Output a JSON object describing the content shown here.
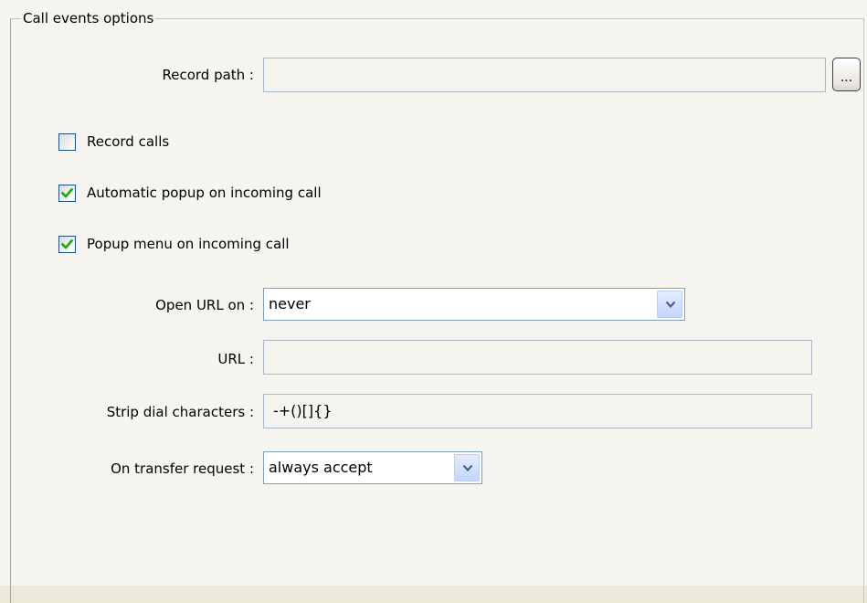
{
  "group": {
    "title": "Call events options"
  },
  "record_path": {
    "label": "Record path :",
    "value": "",
    "browse_label": "..."
  },
  "checkboxes": {
    "record_calls": {
      "label": "Record calls",
      "checked": false
    },
    "auto_popup": {
      "label": "Automatic popup on incoming call",
      "checked": true
    },
    "popup_menu": {
      "label": "Popup menu on incoming call",
      "checked": true
    }
  },
  "open_url_on": {
    "label": "Open URL on :",
    "value": "never"
  },
  "url": {
    "label": "URL :",
    "value": ""
  },
  "strip_dial": {
    "label": "Strip dial characters :",
    "value": "-+()[]{}"
  },
  "on_transfer": {
    "label": "On transfer request :",
    "value": "always accept"
  },
  "colors": {
    "check_mark": "#21a121",
    "arrow": "#4d6185",
    "field_border": "#7f9db9"
  }
}
